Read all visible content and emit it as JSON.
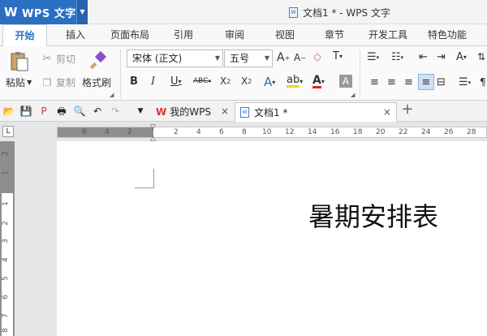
{
  "app": {
    "name": "WPS 文字",
    "doc_title": "文档1 * - WPS 文字"
  },
  "menu": [
    "开始",
    "插入",
    "页面布局",
    "引用",
    "审阅",
    "视图",
    "章节",
    "开发工具",
    "特色功能"
  ],
  "ribbon": {
    "paste": "粘贴",
    "cut": "剪切",
    "copy": "复制",
    "format_painter": "格式刷",
    "font_name": "宋体 (正文)",
    "font_size": "五号"
  },
  "tabs": [
    {
      "label": "我的WPS"
    },
    {
      "label": "文档1 *"
    }
  ],
  "ruler": {
    "h_left": [
      "6",
      "4",
      "2"
    ],
    "h_right": [
      "2",
      "4",
      "6",
      "8",
      "10",
      "12",
      "14",
      "16",
      "18",
      "20",
      "22",
      "24",
      "26",
      "28"
    ],
    "v_top": [
      "2",
      "1"
    ],
    "v_main": [
      "1",
      "2",
      "3",
      "4",
      "5",
      "6",
      "7",
      "8"
    ]
  },
  "document": {
    "heading": "暑期安排表"
  },
  "colors": {
    "accent": "#2b6fc3",
    "font_red": "#e02020",
    "highlight": "#f7d21e"
  }
}
